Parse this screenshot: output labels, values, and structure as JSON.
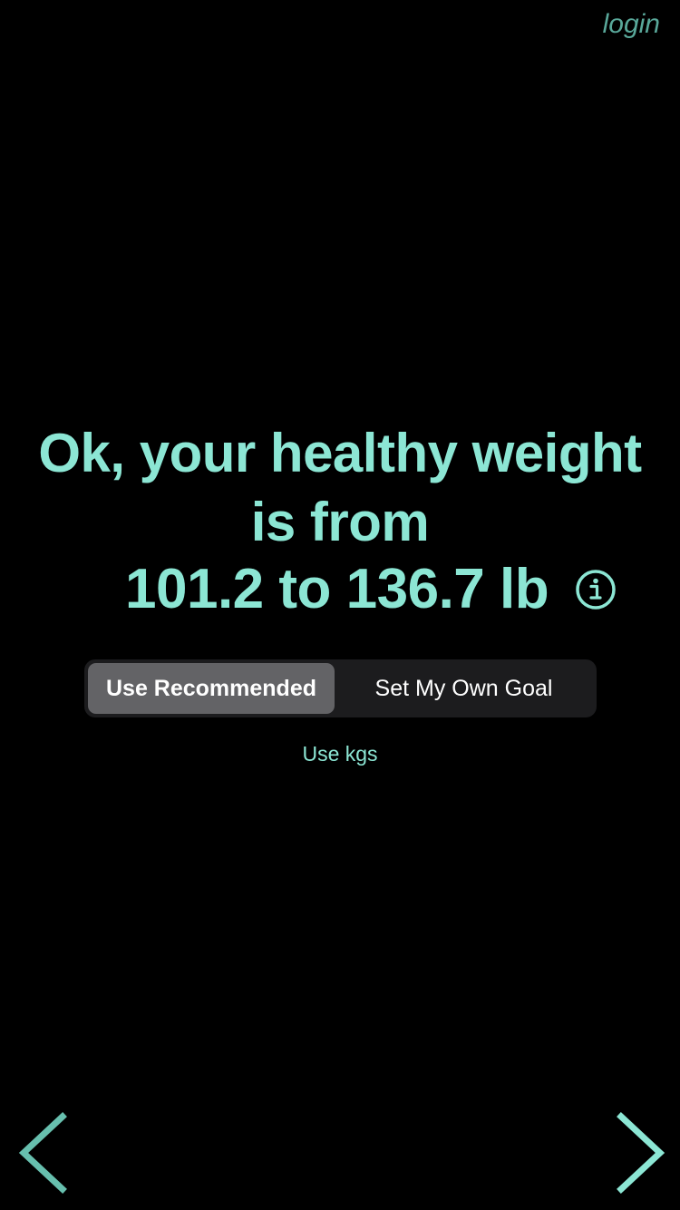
{
  "header": {
    "login_label": "login"
  },
  "main": {
    "headline_line1": "Ok, your healthy weight",
    "headline_line2": "is from",
    "range_text": "101.2 to 136.7 lb",
    "info_icon": "info-circle-icon"
  },
  "goal_toggle": {
    "options": [
      "Use Recommended",
      "Set My Own Goal"
    ],
    "selected": "Use Recommended"
  },
  "units_link": "Use kgs",
  "navigation": {
    "back_icon": "chevron-left-icon",
    "next_icon": "chevron-right-icon"
  },
  "colors": {
    "background": "#000000",
    "accent": "#8ce6d4",
    "login": "#59a89a",
    "segment_bg": "#1c1c1e",
    "segment_selected_bg": "#636366",
    "segment_text": "#ffffff"
  }
}
